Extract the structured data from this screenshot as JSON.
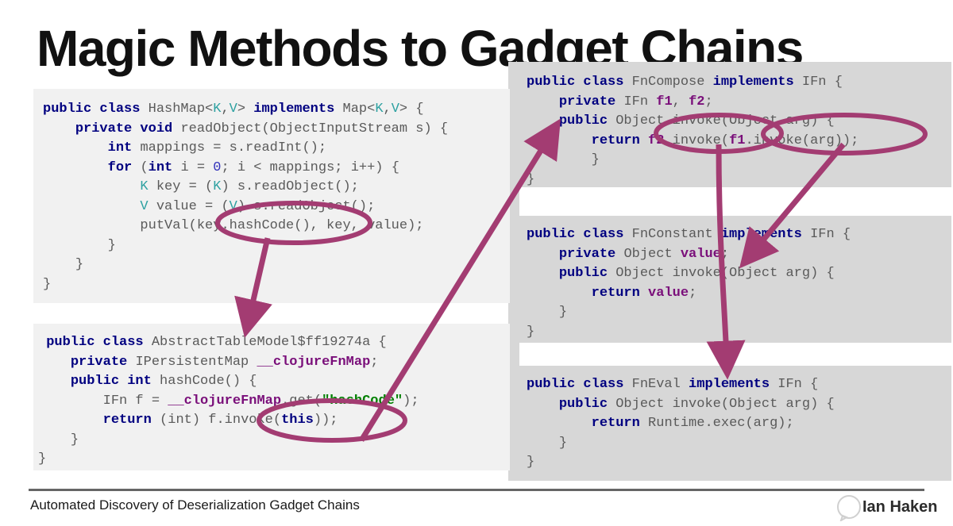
{
  "slide": {
    "title": "Magic Methods to Gadget Chains",
    "background_color": "#ffffff",
    "code_block_left_bg": "#f1f1f1",
    "code_block_right_bg": "#d7d7d7",
    "annotation_color": "#a33c72"
  },
  "syntax_colors": {
    "keyword": "#000080",
    "type": "#2ea1a1",
    "number": "#3333bb",
    "field": "#7a0f7a",
    "string": "#008000",
    "plain": "#5a5a5a"
  },
  "code_blocks": {
    "hashmap": {
      "name": "HashMap",
      "lines": [
        "public class HashMap<K,V> implements Map<K,V> {",
        "    private void readObject(ObjectInputStream s) {",
        "        int mappings = s.readInt();",
        "        for (int i = 0; i < mappings; i++) {",
        "            K key = (K) s.readObject();",
        "            V value = (V) s.readObject();",
        "            putVal(key.hashCode(), key, value);",
        "        }",
        "    }",
        "}"
      ]
    },
    "abstracttablemodel": {
      "name": "AbstractTableModel$ff19274a",
      "lines": [
        "public class AbstractTableModel$ff19274a {",
        "    private IPersistentMap __clojureFnMap;",
        "    public int hashCode() {",
        "        IFn f = __clojureFnMap.get(\"hashCode\");",
        "        return (int) f.invoke(this);",
        "    }",
        "}"
      ]
    },
    "fncompose": {
      "name": "FnCompose",
      "lines": [
        "public class FnCompose implements IFn {",
        "    private IFn f1, f2;",
        "    public Object invoke(Object arg) {",
        "        return f2.invoke(f1.invoke(arg));",
        "    }",
        "}"
      ]
    },
    "fnconstant": {
      "name": "FnConstant",
      "lines": [
        "public class FnConstant implements IFn {",
        "    private Object value;",
        "    public Object invoke(Object arg) {",
        "        return value;",
        "    }",
        "}"
      ]
    },
    "fneval": {
      "name": "FnEval",
      "lines": [
        "public class FnEval implements IFn {",
        "    public Object invoke(Object arg) {",
        "        return Runtime.exec(arg);",
        "    }",
        "}"
      ]
    }
  },
  "annotations": {
    "ellipses": [
      {
        "id": "ellipse-hashcode-call",
        "label": "key.hashCode(),"
      },
      {
        "id": "ellipse-f-invoke-this",
        "label": "f.invoke(this)"
      },
      {
        "id": "ellipse-f2-invoke",
        "label": "f2.invoke(f1"
      },
      {
        "id": "ellipse-f1-invoke-arg",
        "label": "f1).invoke(arg));"
      }
    ],
    "arrows": [
      {
        "id": "arrow-hashcode-to-tablemodel",
        "from": "ellipse-hashcode-call",
        "to": "abstracttablemodel"
      },
      {
        "id": "arrow-tablemodel-to-fncompose",
        "from": "ellipse-f-invoke-this",
        "to": "fncompose"
      },
      {
        "id": "arrow-f2-to-fneval",
        "from": "ellipse-f2-invoke",
        "to": "fneval"
      },
      {
        "id": "arrow-f1-to-fnconstant",
        "from": "ellipse-f1-invoke-arg",
        "to": "fnconstant"
      }
    ]
  },
  "footer": {
    "text": "Automated Discovery of Deserialization Gadget Chains",
    "author": "Ian Haken"
  }
}
